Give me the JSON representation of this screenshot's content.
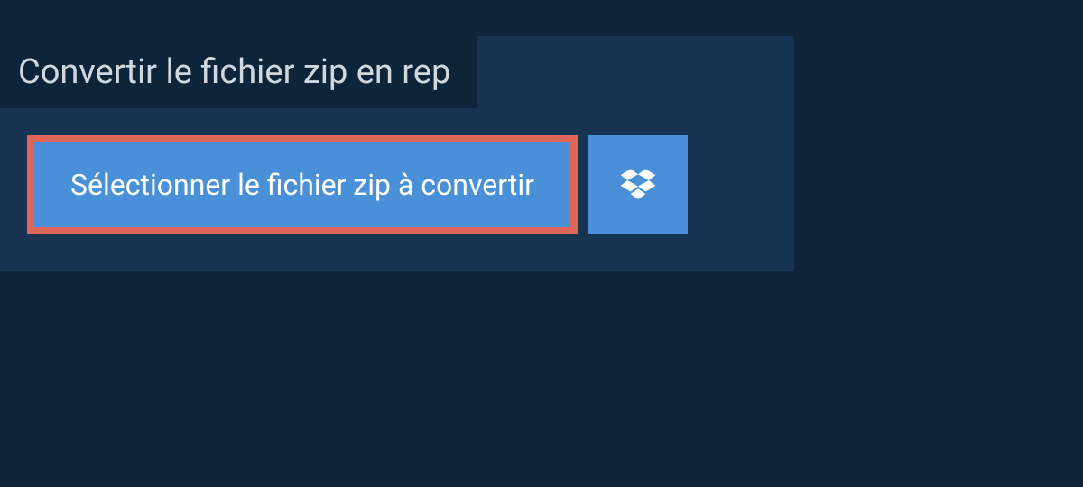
{
  "colors": {
    "page_bg": "#0d2439",
    "panel_bg": "#163452",
    "button_bg": "#4a90d9",
    "highlight_border": "#e06659",
    "title_text": "#cfd8de",
    "button_text": "#ffffff"
  },
  "title": "Convertir le fichier zip en rep",
  "select_button_label": "Sélectionner le fichier zip à convertir",
  "dropbox_icon_name": "dropbox-icon"
}
